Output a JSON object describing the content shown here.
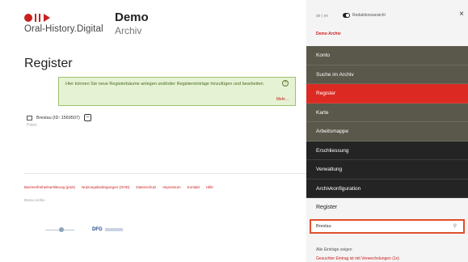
{
  "header": {
    "logo_text": "Oral-History.Digital",
    "archive_title": "Demo",
    "archive_subtitle": "Archiv"
  },
  "main": {
    "page_title": "Register",
    "info_text": "Hier können Sie neue Registerbäume anlegen und/oder Registereinträge hinzufügen und bearbeiten.",
    "info_more": "Mehr...",
    "tree_item_label": "Breslau (ID: 1569507)",
    "tree_item_sub": "Polen"
  },
  "footer": {
    "links": [
      "Barrierefreiheitserklärung (jetzt)",
      "Nutzungsbedingungen (OHD)",
      "Datenschutz",
      "Impressum",
      "Kontakt",
      "Hilfe"
    ],
    "sub": "Demo Archiv"
  },
  "sidebar": {
    "lang": "de | en",
    "toggle_label": "Redaktionsansicht",
    "close_glyph": "×",
    "archive_label": "Demo Archiv",
    "nav": [
      {
        "label": "Konto",
        "style": "olive"
      },
      {
        "label": "Suche im Archiv",
        "style": "olive"
      },
      {
        "label": "Register",
        "style": "active"
      },
      {
        "label": "Karte",
        "style": "olive"
      },
      {
        "label": "Arbeitsmappe",
        "style": "olive"
      },
      {
        "label": "Erschliessung",
        "style": "dark"
      },
      {
        "label": "Verwaltung",
        "style": "dark"
      },
      {
        "label": "Archivkonfiguration",
        "style": "dark"
      }
    ],
    "register_heading": "Register",
    "search_value": "Breslau",
    "all_entries": "Alle Einträge zeigen",
    "warning": "Gesuchter Eintrag ist mit Verwechslungen (1x)"
  },
  "colors": {
    "accent_red": "#dc2a23",
    "olive": "#59584a",
    "dark": "#242424",
    "info_bg": "#e6f2d4"
  }
}
